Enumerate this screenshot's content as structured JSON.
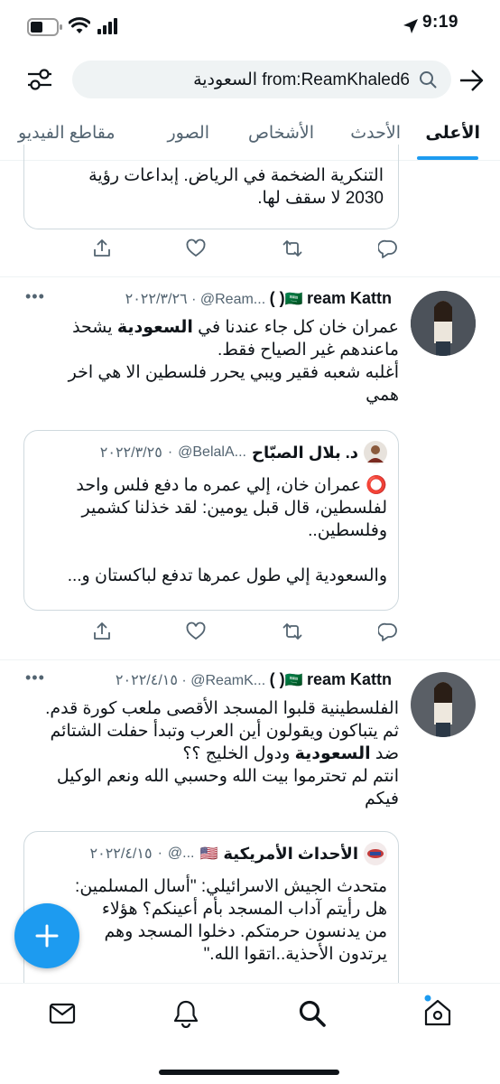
{
  "status_bar": {
    "time": "9:19"
  },
  "search": {
    "query": "from:ReamKhaled6 السعودية"
  },
  "tabs": [
    {
      "label": "الأعلى",
      "active": true
    },
    {
      "label": "الأحدث"
    },
    {
      "label": "الأشخاص"
    },
    {
      "label": "الصور"
    },
    {
      "label": "مقاطع الفيديو"
    }
  ],
  "top_card": {
    "line1": "التنكرية الضخمة في الرياض. إبداعات رؤية",
    "line2": "2030 لا سقف لها."
  },
  "tweets": [
    {
      "name": "ream Kattn( )",
      "flag": "🇸🇦",
      "handle": "@Ream...",
      "sep": "·",
      "date": "٢٠٢٢/٣/٢٦",
      "line1_pre": "عمران خان كل جاء عندنا في ",
      "line1_kw": "السعودية",
      "line1_post": " يشحذ",
      "line2": "ماعندهم غير الصياح فقط.",
      "line3": "أغلبه شعبه فقير ويبي يحرر فلسطين الا هي اخر",
      "line4": "همي",
      "quote": {
        "name": "د. بلال الصبّاح",
        "handle": "@BelalA...",
        "sep": "·",
        "date": "٢٠٢٢/٣/٢٥",
        "mark": "⭕",
        "line1": " عمران خان، إلي عمره ما دفع فلس واحد",
        "line2": "لفلسطين، قال قبل يومين: لقد خذلنا كشمير",
        "line3": "وفلسطين..",
        "line4": "والسعودية إلي طول عمرها تدفع لباكستان و..."
      }
    },
    {
      "name": "ream Kattn( )",
      "flag": "🇸🇦",
      "handle": "@ReamK...",
      "sep": "·",
      "date": "٢٠٢٢/٤/١٥",
      "line1": "الفلسطينية قلبوا المسجد الأقصى ملعب كورة قدم.",
      "line2": "ثم يتباكون ويقولون أين العرب وتبدأ حفلت الشتائم",
      "line3_pre": "ضد ",
      "line3_kw": "السعودية",
      "line3_post": " ودول الخليج ؟؟",
      "line4": "انتم لم تحترموا بيت الله وحسبي الله ونعم الوكيل",
      "line5": "فيكم",
      "quote": {
        "name": "الأحداث الأمريكية",
        "flag": "🇺🇸",
        "handle": "@...",
        "sep": "·",
        "date": "٢٠٢٢/٤/١٥",
        "line1": "متحدث الجيش الاسرائيلي: \"أسال المسلمين:",
        "line2": "هل رأيتم آداب المسجد بأم أعينكم؟ هؤلاء",
        "line3": "من يدنسون حرمتكم. دخلوا المسجد وهم",
        "line4": "يرتدون الأحذية..اتقوا الله.\""
      }
    }
  ],
  "colors": {
    "accent": "#1d9bf0",
    "text": "#0f1419",
    "muted": "#536471",
    "border": "#cfd9de"
  }
}
